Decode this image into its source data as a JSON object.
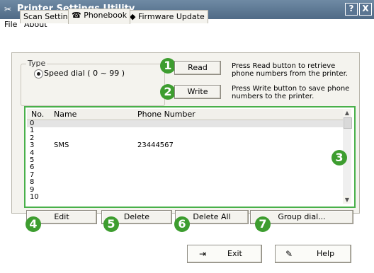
{
  "window": {
    "title": "Printer Settings Utility",
    "help_button": "?",
    "close_button": "X"
  },
  "menu": {
    "file": "File",
    "about": "About"
  },
  "tabs": [
    {
      "label": "Scan Settings"
    },
    {
      "label": "Phonebook"
    },
    {
      "label": "Firmware Update"
    }
  ],
  "type_group": {
    "label": "Type",
    "option": "Speed dial ( 0 ~ 99 )"
  },
  "read": {
    "badge": "1",
    "button": "Read",
    "description": "Press Read button to retrieve phone numbers from the printer."
  },
  "write": {
    "badge": "2",
    "button": "Write",
    "description": "Press Write button to save phone numbers to the printer."
  },
  "list": {
    "badge": "3",
    "columns": {
      "no": "No.",
      "name": "Name",
      "phone": "Phone Number"
    },
    "rows": [
      {
        "no": "0",
        "name": "",
        "phone": ""
      },
      {
        "no": "1",
        "name": "",
        "phone": ""
      },
      {
        "no": "2",
        "name": "",
        "phone": ""
      },
      {
        "no": "3",
        "name": "SMS",
        "phone": "23444567"
      },
      {
        "no": "4",
        "name": "",
        "phone": ""
      },
      {
        "no": "5",
        "name": "",
        "phone": ""
      },
      {
        "no": "6",
        "name": "",
        "phone": ""
      },
      {
        "no": "7",
        "name": "",
        "phone": ""
      },
      {
        "no": "8",
        "name": "",
        "phone": ""
      },
      {
        "no": "9",
        "name": "",
        "phone": ""
      },
      {
        "no": "10",
        "name": "",
        "phone": ""
      }
    ]
  },
  "actions": [
    {
      "badge": "4",
      "label": "Edit"
    },
    {
      "badge": "5",
      "label": "Delete"
    },
    {
      "badge": "6",
      "label": "Delete All"
    },
    {
      "badge": "7",
      "label": "Group dial..."
    }
  ],
  "footer": {
    "exit": "Exit",
    "help": "Help"
  },
  "colors": {
    "title_bar": "#5a7592",
    "badge": "#3d9d2f",
    "list_highlight": "#49b04a"
  }
}
